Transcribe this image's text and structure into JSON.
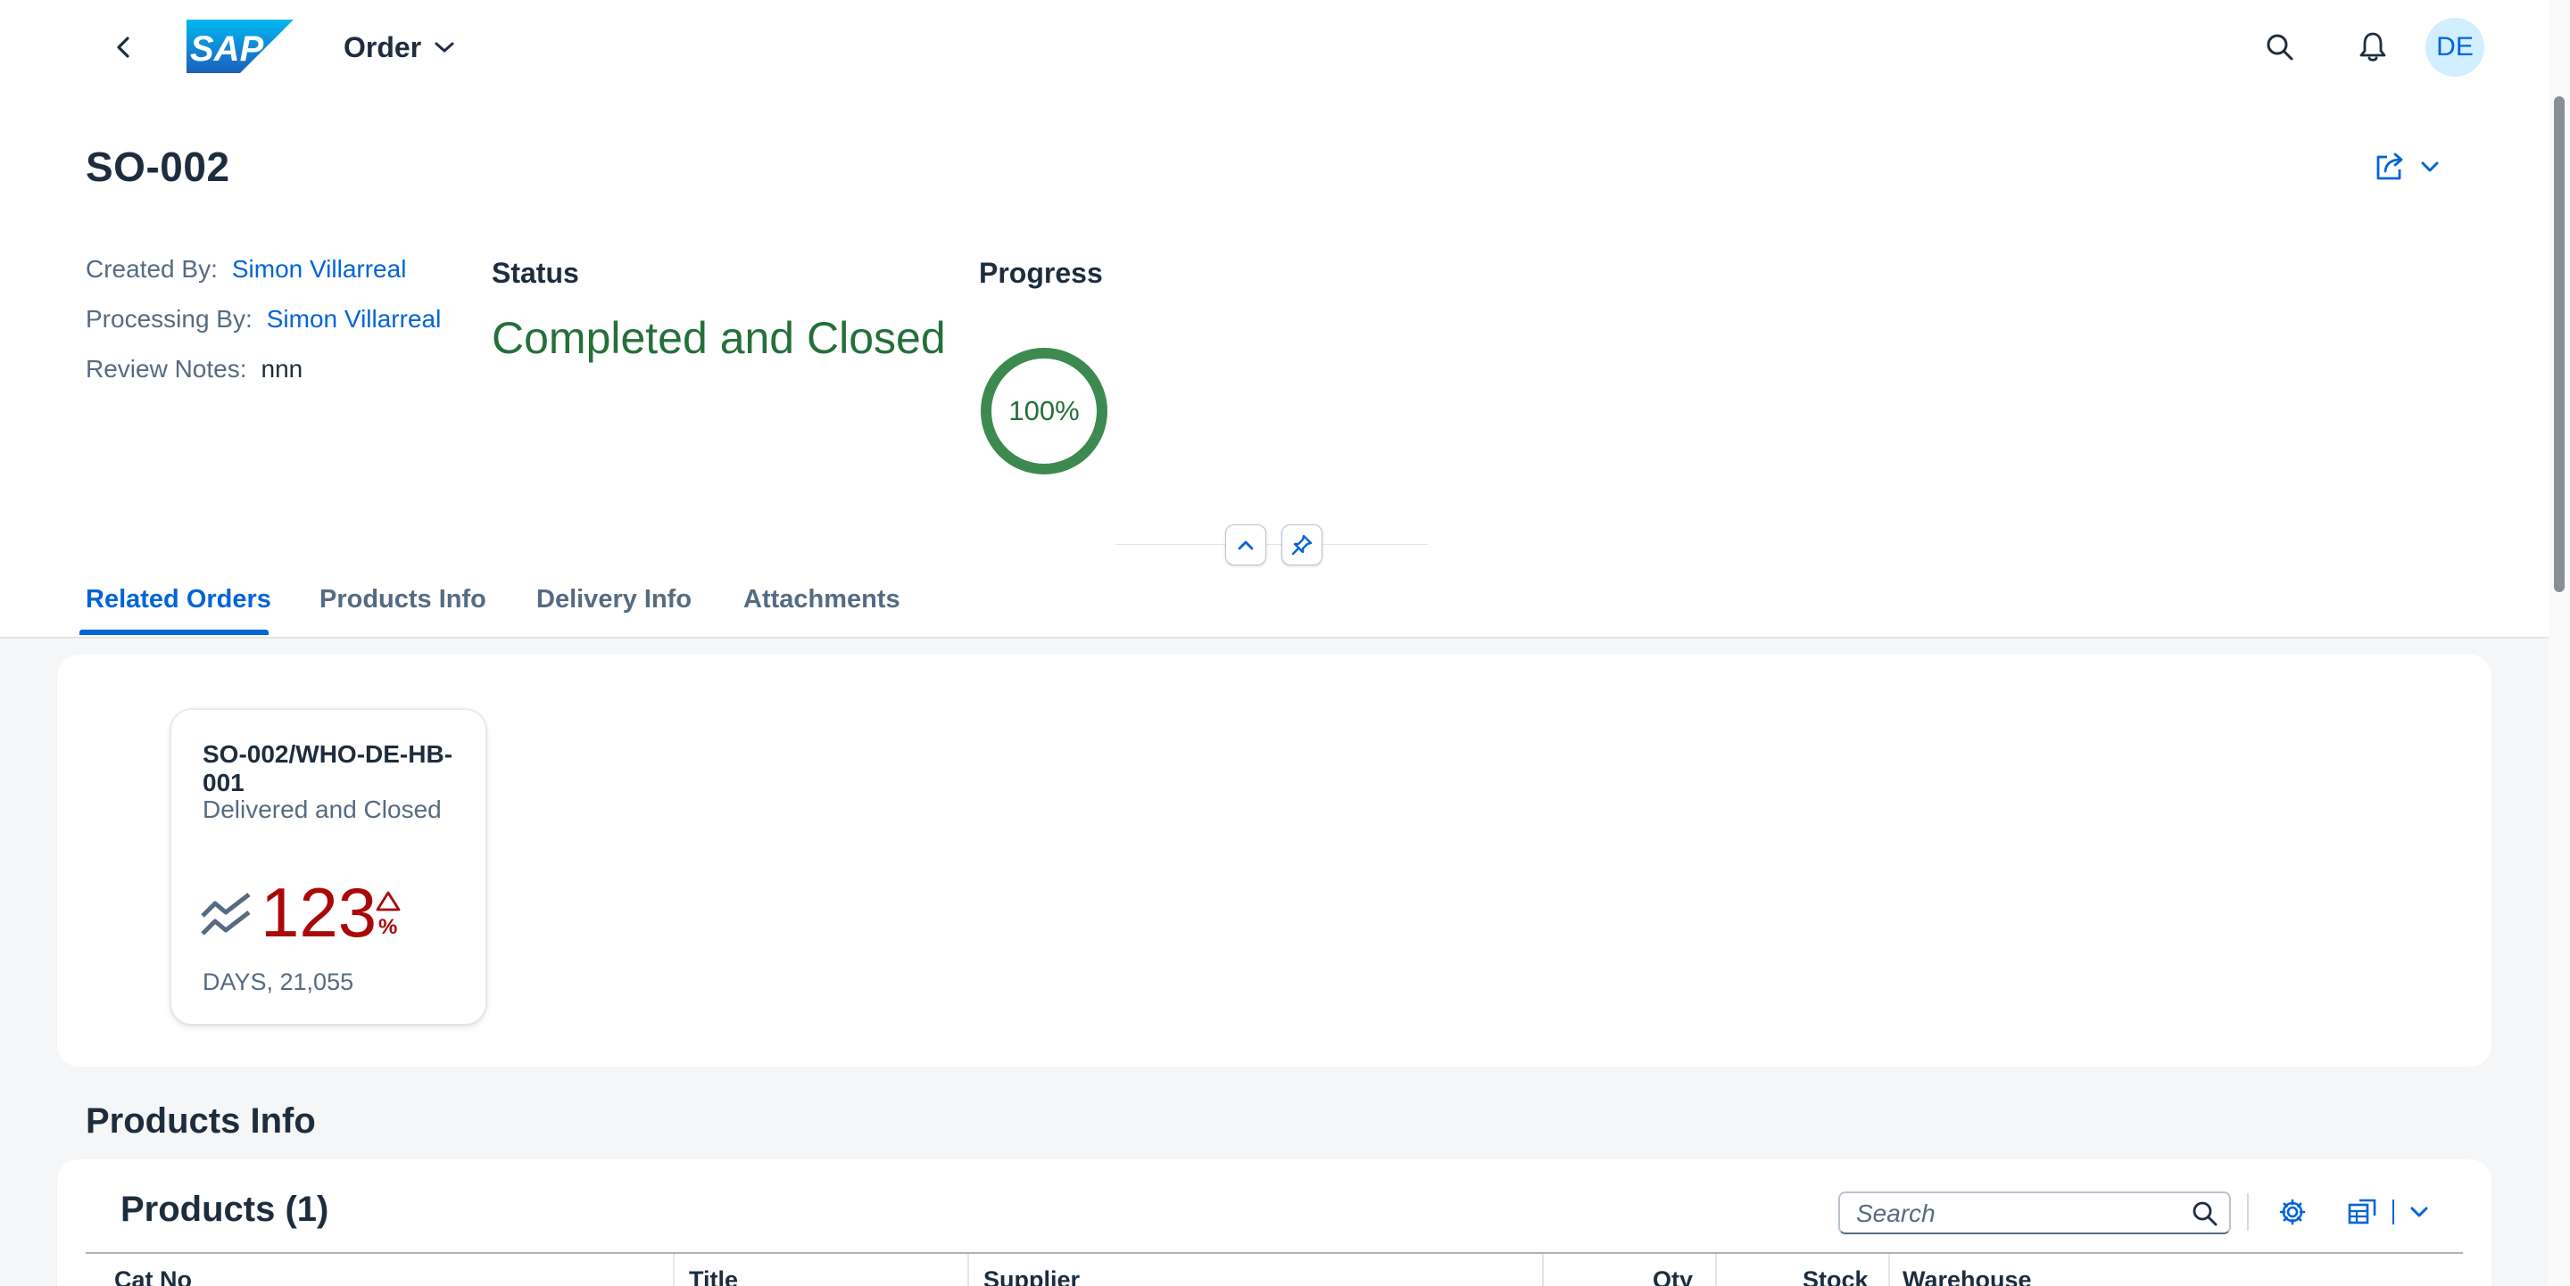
{
  "shell": {
    "app_title": "Order",
    "logo_text": "SAP",
    "avatar_initials": "DE"
  },
  "header": {
    "title": "SO-002",
    "created_by_label": "Created By:",
    "created_by_value": "Simon Villarreal",
    "processing_by_label": "Processing By:",
    "processing_by_value": "Simon Villarreal",
    "review_notes_label": "Review Notes:",
    "review_notes_value": "nnn",
    "status_label": "Status",
    "status_value": "Completed and Closed",
    "progress_label": "Progress",
    "progress_text": "100%",
    "progress_percent": 100
  },
  "tabs": [
    {
      "label": "Related Orders",
      "active": true
    },
    {
      "label": "Products Info",
      "active": false
    },
    {
      "label": "Delivery Info",
      "active": false
    },
    {
      "label": "Attachments",
      "active": false
    }
  ],
  "kpi_card": {
    "title": "SO-002/WHO-DE-HB-001",
    "subtitle": "Delivered and Closed",
    "value": "123",
    "unit": "%",
    "footer": "DAYS, 21,055"
  },
  "products_section": {
    "section_title": "Products Info",
    "table_title": "Products (1)",
    "search_placeholder": "Search",
    "columns": [
      "Cat No",
      "Title",
      "Supplier",
      "Qty",
      "Stock",
      "Warehouse"
    ]
  },
  "colors": {
    "accent": "#0064d9",
    "positive": "#256f3a",
    "negative": "#aa0808",
    "text": "#1d2d3e",
    "muted": "#556b82"
  }
}
